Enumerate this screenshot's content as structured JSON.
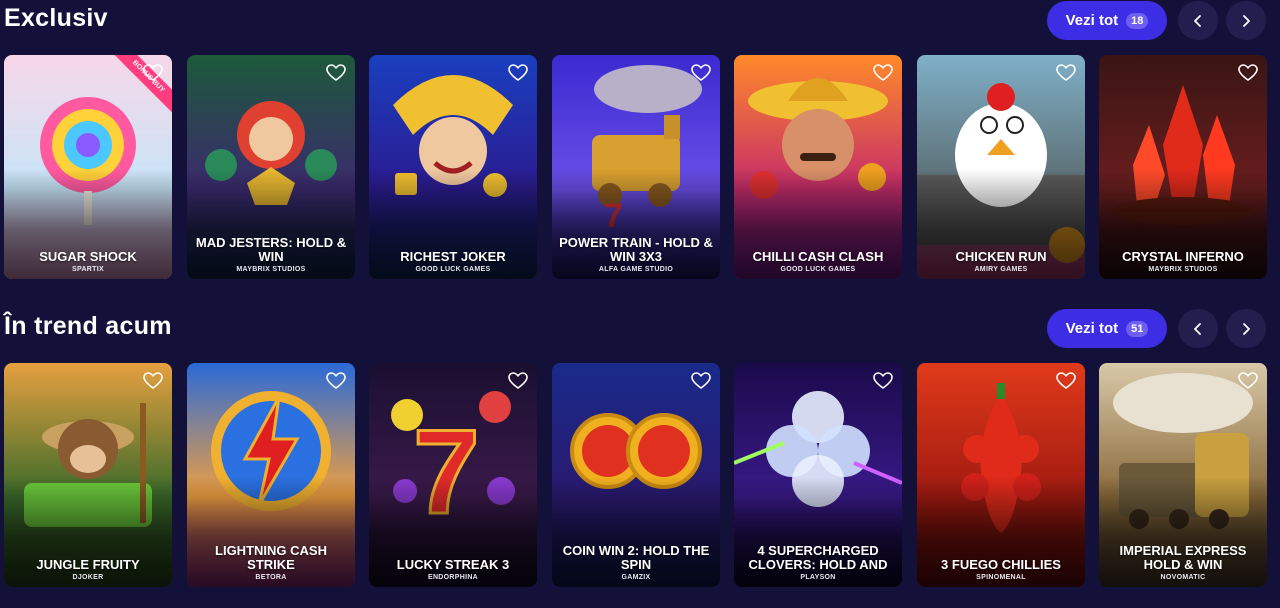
{
  "sections": [
    {
      "title": "Exclusiv",
      "view_all_label": "Vezi tot",
      "count": "18",
      "games": [
        {
          "title": "SUGAR SHOCK",
          "provider": "SPARTIX",
          "badge": "BONUS BUY",
          "theme": "lollipop",
          "colors": [
            "#f7d7e8",
            "#c7e6f9",
            "#f4a6d8"
          ]
        },
        {
          "title": "MAD JESTERS: HOLD & WIN",
          "provider": "MAYBRIX STUDIOS",
          "theme": "jester",
          "colors": [
            "#1d5a3a",
            "#3b2a6e",
            "#0f2a52"
          ]
        },
        {
          "title": "RICHEST JOKER",
          "provider": "GOOD LUCK GAMES",
          "theme": "joker",
          "colors": [
            "#1a3fbf",
            "#2b1b8f",
            "#0c2a66"
          ]
        },
        {
          "title": "POWER TRAIN - HOLD & WIN 3X3",
          "provider": "ALFA GAME STUDIO",
          "theme": "train",
          "colors": [
            "#3b2ad0",
            "#6a4fe8",
            "#1a1470"
          ]
        },
        {
          "title": "CHILLI CASH CLASH",
          "provider": "GOOD LUCK GAMES",
          "theme": "mexican",
          "colors": [
            "#ff8a2a",
            "#c42c6a",
            "#7a1aa0"
          ]
        },
        {
          "title": "CHICKEN RUN",
          "provider": "AMIRY GAMES",
          "theme": "chicken",
          "colors": [
            "#7fb0c8",
            "#5a6a6e",
            "#c03a7a"
          ]
        },
        {
          "title": "CRYSTAL INFERNO",
          "provider": "MAYBRIX STUDIOS",
          "theme": "crystal",
          "colors": [
            "#3a1414",
            "#6a1e1e",
            "#2a0c10"
          ]
        }
      ]
    },
    {
      "title": "În trend acum",
      "view_all_label": "Vezi tot",
      "count": "51",
      "games": [
        {
          "title": "JUNGLE FRUITY",
          "provider": "DJOKER",
          "theme": "monkey",
          "colors": [
            "#e6a040",
            "#3a6a2a",
            "#2a4a1a"
          ]
        },
        {
          "title": "LIGHTNING CASH STRIKE",
          "provider": "BETORA",
          "theme": "lightning",
          "colors": [
            "#2a6ad8",
            "#f0a040",
            "#a02a8a"
          ]
        },
        {
          "title": "LUCKY STREAK 3",
          "provider": "ENDORPHINA",
          "theme": "seven",
          "colors": [
            "#1a0f30",
            "#3a1a4a",
            "#120a24"
          ]
        },
        {
          "title": "COIN WIN 2: HOLD THE SPIN",
          "provider": "GAMZIX",
          "theme": "coins",
          "colors": [
            "#1a2a8a",
            "#2a1a70",
            "#0f1a5a"
          ]
        },
        {
          "title": "4 SUPERCHARGED CLOVERS: HOLD AND",
          "provider": "PLAYSON",
          "theme": "clover",
          "colors": [
            "#1a0a4a",
            "#3a1a8a",
            "#0a0630"
          ]
        },
        {
          "title": "3 FUEGO CHILLIES",
          "provider": "SPINOMENAL",
          "theme": "chilli",
          "colors": [
            "#e03a1a",
            "#a01a10",
            "#6a0a0a"
          ]
        },
        {
          "title": "IMPERIAL EXPRESS HOLD & WIN",
          "provider": "NOVOMATIC",
          "theme": "imperial",
          "colors": [
            "#d8c8a8",
            "#8a6a3a",
            "#4a3a2a"
          ]
        }
      ]
    }
  ]
}
